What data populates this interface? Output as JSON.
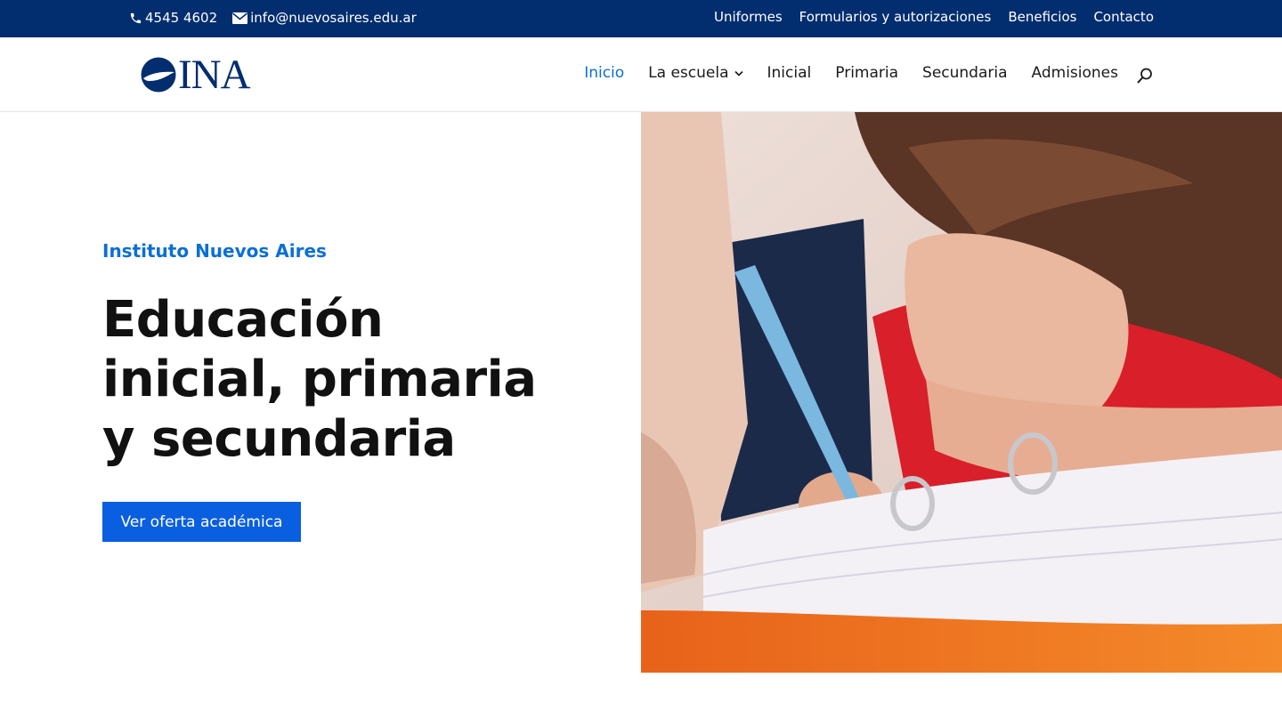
{
  "topbar": {
    "phone": "4545 4602",
    "email": "info@nuevosaires.edu.ar",
    "links": [
      "Uniformes",
      "Formularios y autorizaciones",
      "Beneficios",
      "Contacto"
    ]
  },
  "header": {
    "logo_text": "INA",
    "nav": [
      "Inicio",
      "La escuela",
      "Inicial",
      "Primaria",
      "Secundaria",
      "Admisiones"
    ],
    "active": "Inicio"
  },
  "hero": {
    "eyebrow": "Instituto Nuevos Aires",
    "headline": "Educación inicial, primaria y secundaria",
    "cta": "Ver oferta académica"
  },
  "colors": {
    "topbar_bg": "#022d6e",
    "accent": "#0a6fd6",
    "button_bg": "#0a5fe0"
  },
  "icons": {
    "phone": "phone-icon",
    "email": "envelope-icon",
    "search": "search-icon",
    "caret": "chevron-down-icon"
  }
}
